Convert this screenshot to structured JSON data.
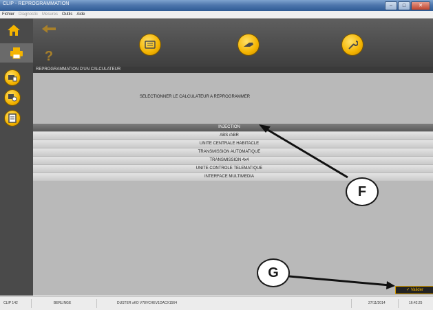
{
  "window": {
    "title": "CLIP - REPROGRAMMATION",
    "controls": [
      "–",
      "□",
      "✕"
    ]
  },
  "menubar": {
    "items": [
      {
        "label": "Fichier",
        "enabled": true
      },
      {
        "label": "Diagnostic",
        "enabled": false
      },
      {
        "label": "Mesures",
        "enabled": false
      },
      {
        "label": "Outils",
        "enabled": true
      },
      {
        "label": "Aide",
        "enabled": true
      }
    ]
  },
  "header": {
    "text": "REPROGRAMMATION D'UN CALCULATEUR"
  },
  "main": {
    "instruction": "SELECTIONNER LE CALCULATEUR A REPROGRAMMER",
    "calculators": [
      {
        "label": "INJECTION",
        "selected": true
      },
      {
        "label": "ABS /ABR",
        "selected": false
      },
      {
        "label": "UNITE CENTRALE HABITACLE",
        "selected": false
      },
      {
        "label": "TRANSMISSION AUTOMATIQUE",
        "selected": false
      },
      {
        "label": "TRANSMISSION 4x4",
        "selected": false
      },
      {
        "label": "UNITE CONTROLE TELEMATIQUE",
        "selected": false
      },
      {
        "label": "INTERFACE MULTIMEDIA",
        "selected": false
      }
    ],
    "validate_label": "Valider"
  },
  "statusbar": {
    "fields": [
      "CLIP 142",
      "BERLINGE",
      "DUSTER sKO V78VCHEV1DACX1564",
      "27/11/2014",
      "16:42:25"
    ]
  },
  "callouts": {
    "F": "F",
    "G": "G"
  },
  "colors": {
    "accent": "#f4b400",
    "toolbar": "#4a4a4a",
    "panel": "#b9b9b9",
    "selected_row": "#6a6a6a"
  },
  "icons": {
    "left": [
      "home-icon",
      "print-icon",
      "ecu-info-icon",
      "ecu-config-icon",
      "document-icon"
    ],
    "toolbar": [
      "back-arrow-icon",
      "help-question-icon",
      "ecu-module-icon",
      "sensor-probe-icon",
      "wrench-icon"
    ]
  }
}
